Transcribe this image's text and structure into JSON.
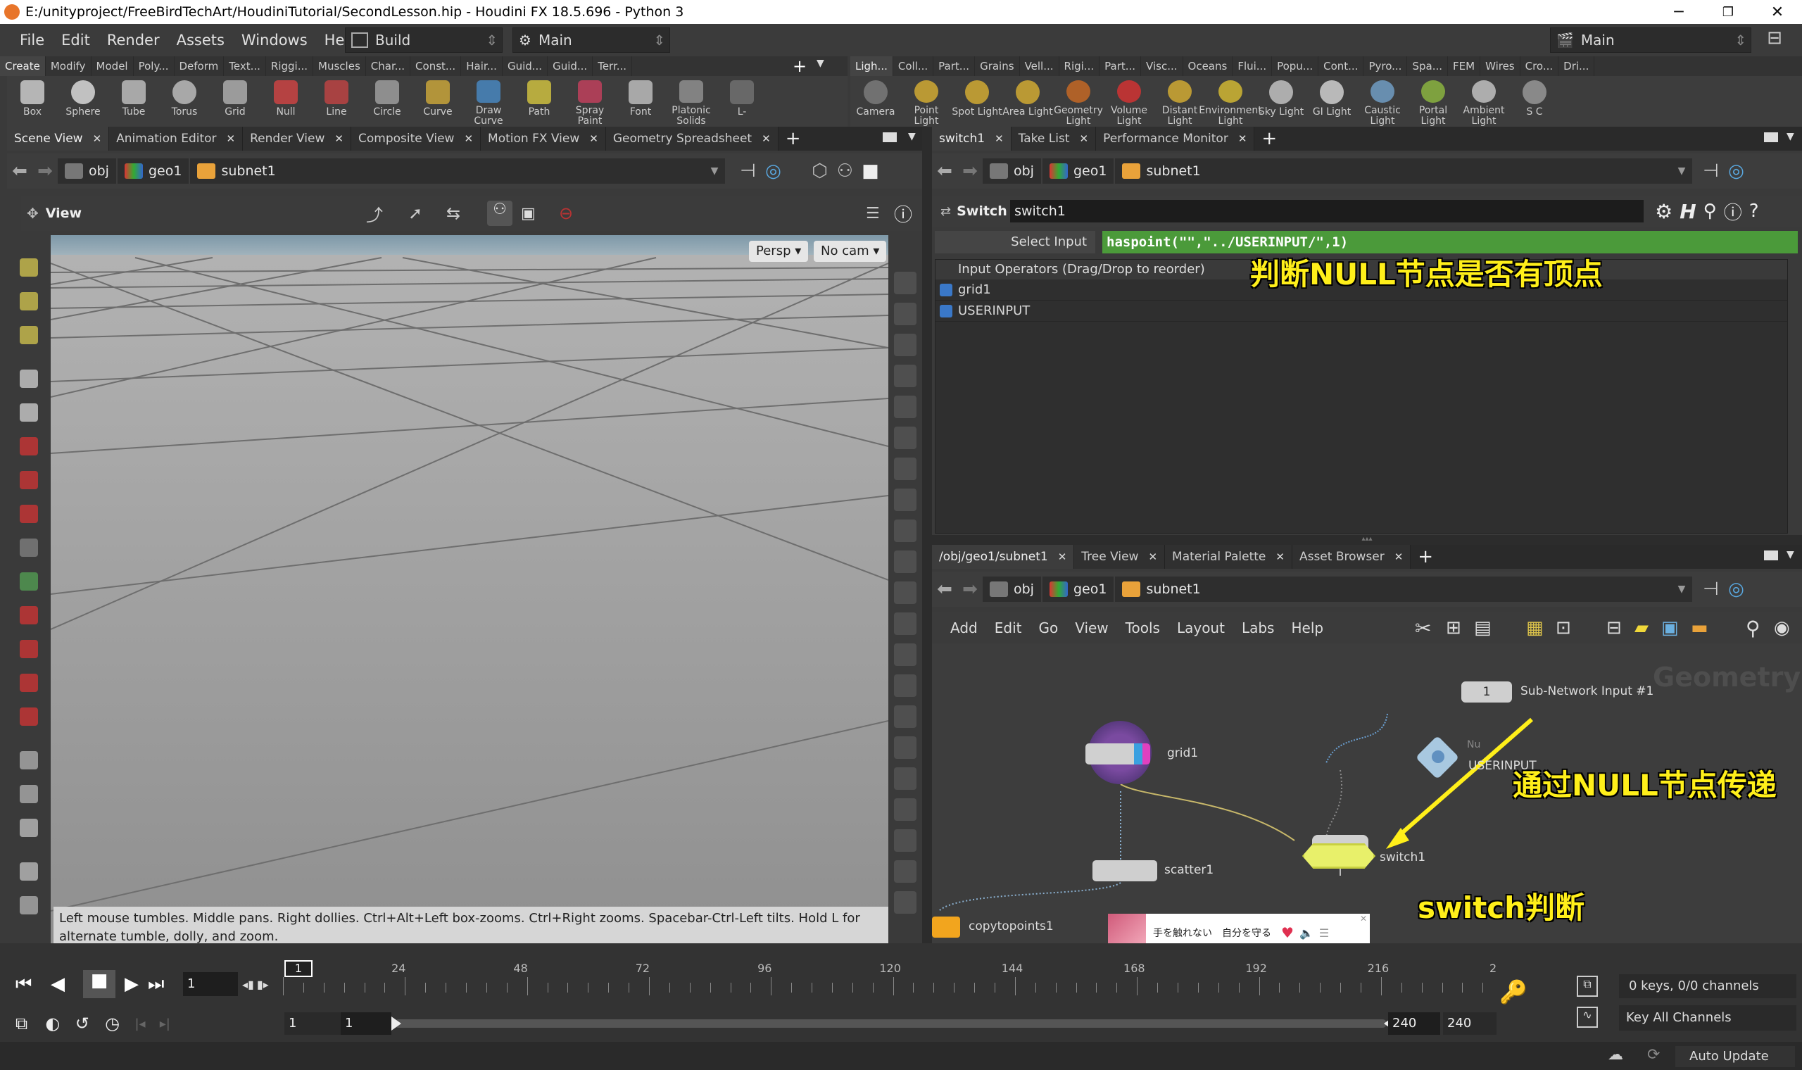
{
  "window": {
    "title": "E:/unityproject/FreeBirdTechArt/HoudiniTutorial/SecondLesson.hip - Houdini FX 18.5.696 - Python 3"
  },
  "menu": {
    "items": [
      "File",
      "Edit",
      "Render",
      "Assets",
      "Windows",
      "Help"
    ],
    "desktop": "Build",
    "context": "Main",
    "right_desktop": "Main"
  },
  "shelf_left": {
    "tabs": [
      "Create",
      "Modify",
      "Model",
      "Poly...",
      "Deform",
      "Text...",
      "Riggi...",
      "Muscles",
      "Char...",
      "Const...",
      "Hair...",
      "Guid...",
      "Guid...",
      "Terr..."
    ],
    "tools": [
      "Box",
      "Sphere",
      "Tube",
      "Torus",
      "Grid",
      "Null",
      "Line",
      "Circle",
      "Curve",
      "Draw Curve",
      "Path",
      "Spray Paint",
      "Font",
      "Platonic Solids",
      "L-"
    ]
  },
  "shelf_right": {
    "tabs": [
      "Ligh...",
      "Coll...",
      "Part...",
      "Grains",
      "Vell...",
      "Rigi...",
      "Part...",
      "Visc...",
      "Oceans",
      "Flui...",
      "Popu...",
      "Cont...",
      "Pyro...",
      "Spa...",
      "FEM",
      "Wires",
      "Cro...",
      "Dri..."
    ],
    "tools": [
      "Camera",
      "Point Light",
      "Spot Light",
      "Area Light",
      "Geometry Light",
      "Volume Light",
      "Distant Light",
      "Environment Light",
      "Sky Light",
      "GI Light",
      "Caustic Light",
      "Portal Light",
      "Ambient Light",
      "S C"
    ]
  },
  "left_tabs": [
    "Scene View",
    "Animation Editor",
    "Render View",
    "Composite View",
    "Motion FX View",
    "Geometry Spreadsheet"
  ],
  "path": {
    "obj": "obj",
    "geo": "geo1",
    "subnet": "subnet1"
  },
  "viewport": {
    "label": "View",
    "persp": "Persp",
    "cam": "No cam",
    "help": "Left mouse tumbles. Middle pans. Right dollies. Ctrl+Alt+Left box-zooms. Ctrl+Right zooms. Spacebar-Ctrl-Left tilts. Hold L for alternate tumble, dolly, and zoom."
  },
  "param_tabs": [
    "switch1",
    "Take List",
    "Performance Monitor"
  ],
  "params": {
    "type": "Switch",
    "name": "switch1",
    "select_label": "Select Input",
    "select_expr": "haspoint(\"\",\"../USERINPUT/\",1)",
    "inputs_header": "Input Operators (Drag/Drop to reorder)",
    "inputs": [
      "grid1",
      "USERINPUT"
    ]
  },
  "net_tabs": [
    "/obj/geo1/subnet1",
    "Tree View",
    "Material Palette",
    "Asset Browser"
  ],
  "net_menu": [
    "Add",
    "Edit",
    "Go",
    "View",
    "Tools",
    "Layout",
    "Labs",
    "Help"
  ],
  "network": {
    "watermark": "Geometry",
    "nodes": {
      "subnet_input": "Sub-Network Input #1",
      "subnet_input_num": "1",
      "grid": "grid1",
      "null": "USERINPUT",
      "null_hint": "Nu",
      "switch": "switch1",
      "scatter": "scatter1",
      "copy": "copytopoints1"
    }
  },
  "annotations": {
    "a1": "判断NULL节点是否有顶点",
    "a2": "通过NULL节点传递",
    "a3": "switch判断"
  },
  "ad": {
    "text": "手を触れない　自分を守る"
  },
  "timeline": {
    "ticks": [
      "1",
      "24",
      "48",
      "72",
      "96",
      "120",
      "144",
      "168",
      "192",
      "216",
      "2"
    ],
    "frame": "1",
    "start": "1",
    "start2": "1",
    "end": "240",
    "end2": "240",
    "keys": "0 keys, 0/0 channels",
    "key_all": "Key All Channels"
  },
  "status": {
    "auto_update": "Auto Update"
  },
  "colors": {
    "accent": "#4b9a3a",
    "anno": "#ffef1a",
    "switch": "#e8f06a"
  }
}
